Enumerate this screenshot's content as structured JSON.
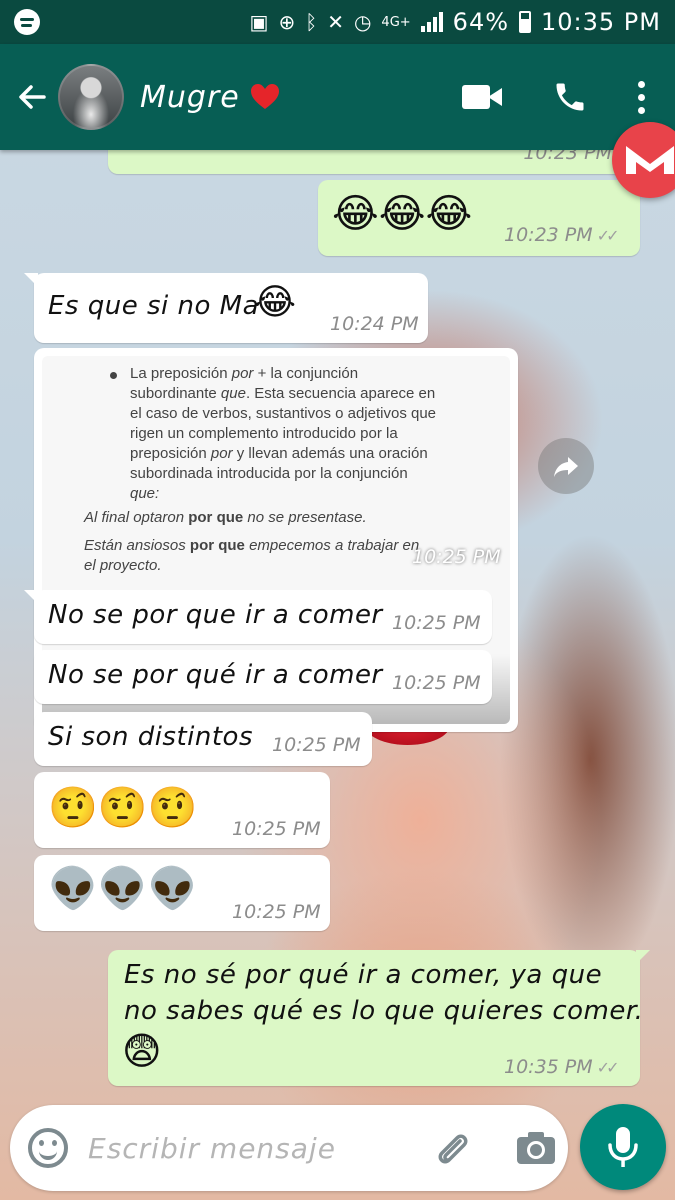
{
  "status_bar": {
    "network": "4G+",
    "battery": "64%",
    "time": "10:35 PM",
    "icons": [
      "spotify-icon",
      "battery-saver-icon",
      "data-saver-icon",
      "bluetooth-icon",
      "mute-icon",
      "alarm-icon",
      "signal-icon",
      "battery-icon"
    ]
  },
  "header": {
    "contact_name": "Mugre",
    "contact_emoji": "heart-icon",
    "actions": [
      "video-call-icon",
      "phone-icon",
      "more-options-icon"
    ],
    "colors": {
      "bar": "#075e54",
      "status": "#0a4a40"
    }
  },
  "messages": [
    {
      "direction": "out",
      "emoji": "😂😂😂",
      "time": "10:23 PM",
      "ticks": "✓✓"
    },
    {
      "direction": "in",
      "text": "Es que si no Ma",
      "emoji": "😂",
      "time": "10:24 PM"
    },
    {
      "direction": "in",
      "type": "image",
      "time": "10:25 PM",
      "image": {
        "para_a": "La preposición ",
        "para_a_em": "por",
        "para_b": " + la conjunción\nsubordinante ",
        "para_b_em": "que",
        "para_c": ". Esta secuencia aparece en\nel caso de verbos, sustantivos o adjetivos que\nrigen un complemento introducido por la\npreposición ",
        "para_c_em": "por",
        "para_d": " y llevan además una oración\nsubordinada introducida por la conjunción\n",
        "para_d_em": "que:",
        "ex1_a": "Al final optaron ",
        "ex1_b": "por que",
        "ex1_c": " no se presentase.",
        "ex2_a": "Están ansiosos ",
        "ex2_b": "por que",
        "ex2_c": " empecemos a trabajar en\nel proyecto."
      }
    },
    {
      "direction": "in",
      "text": "No se por que ir a comer",
      "time": "10:25 PM"
    },
    {
      "direction": "in",
      "text": "No se por qué ir a comer",
      "time": "10:25 PM"
    },
    {
      "direction": "in",
      "text": "Si son distintos",
      "time": "10:25 PM"
    },
    {
      "direction": "in",
      "emoji": "🤨🤨🤨",
      "time": "10:25 PM"
    },
    {
      "direction": "in",
      "emoji": "👽👽👽",
      "time": "10:25 PM"
    },
    {
      "direction": "out",
      "text_line1": "Es no sé por qué ir a comer, ya que",
      "text_line2": "no sabes qué es lo que quieres comer.",
      "emoji": "😨",
      "time": "10:35 PM",
      "ticks": "✓✓"
    }
  ],
  "composer": {
    "placeholder": "Escribir mensaje",
    "icons": [
      "emoji-icon",
      "attach-icon",
      "camera-icon",
      "mic-icon"
    ],
    "accent": "#00897b"
  }
}
